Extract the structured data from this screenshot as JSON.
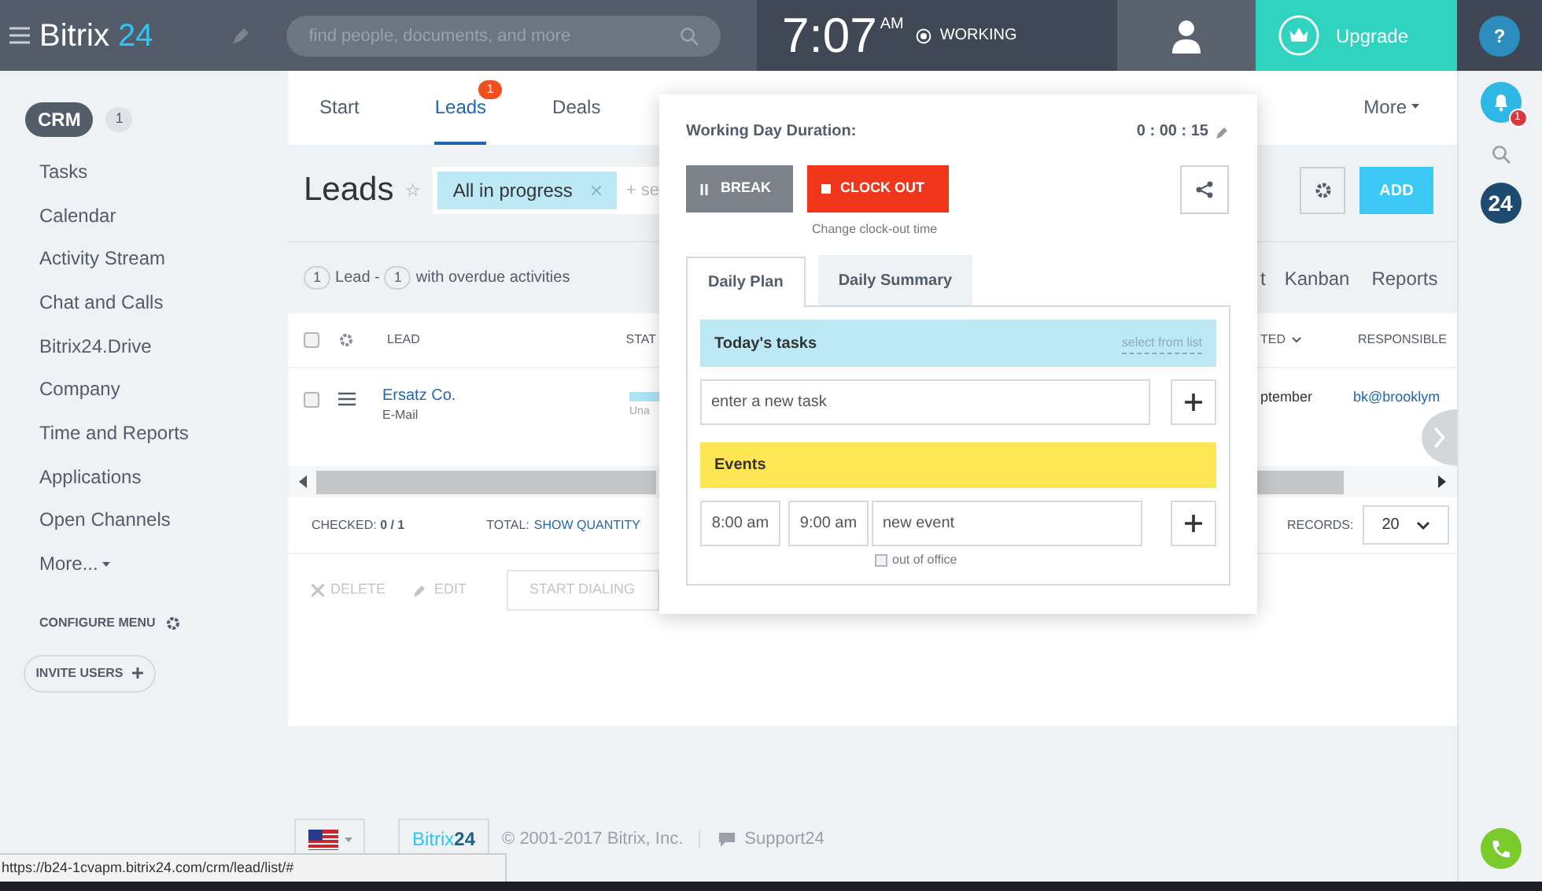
{
  "top_bar": {
    "logo": "Bitrix",
    "logo_accent": "24",
    "search_placeholder": "find people, documents, and more",
    "time": "7:07",
    "time_suffix": "AM",
    "work_status": "WORKING",
    "upgrade": "Upgrade"
  },
  "sidebar": {
    "items": [
      {
        "label": "CRM",
        "counter": "1",
        "selected": true
      },
      {
        "label": "Tasks",
        "selected": false
      },
      {
        "label": "Calendar",
        "selected": false
      },
      {
        "label": "Activity Stream",
        "selected": false
      },
      {
        "label": "Chat and Calls",
        "selected": false
      },
      {
        "label": "Bitrix24.Drive",
        "selected": false
      },
      {
        "label": "Company",
        "selected": false
      },
      {
        "label": "Time and Reports",
        "selected": false
      },
      {
        "label": "Applications",
        "selected": false
      },
      {
        "label": "Open Channels",
        "selected": false
      },
      {
        "label": "More...",
        "selected": false,
        "dropdown": true
      }
    ],
    "configure": "CONFIGURE MENU",
    "invite": "INVITE USERS"
  },
  "tabs": [
    {
      "label": "Start",
      "selected": false
    },
    {
      "label": "Leads",
      "selected": true,
      "badge": "1"
    },
    {
      "label": "Deals",
      "selected": false
    },
    {
      "label": "More",
      "selected": false,
      "dropdown": true
    }
  ],
  "page": {
    "title": "Leads",
    "filter_tag": "All in progress",
    "filter_hint": "+ se",
    "add": "ADD"
  },
  "counters": {
    "lead_count": "1",
    "lead_label": "Lead -",
    "overdue_count": "1",
    "overdue_label": "with overdue activities"
  },
  "views": [
    {
      "label": "t"
    },
    {
      "label": "Kanban"
    },
    {
      "label": "Reports"
    }
  ],
  "table": {
    "header_checked": false,
    "columns": [
      "LEAD",
      "STAT",
      "TED",
      "RESPONSIBLE"
    ],
    "rows": [
      {
        "checked": false,
        "name": "Ersatz Co.",
        "source": "E-Mail",
        "status": "Una",
        "date": "ptember",
        "responsible": "bk@brooklym"
      }
    ]
  },
  "list_footer": {
    "checked_label": "CHECKED:",
    "checked_value": "0 / 1",
    "total_label": "TOTAL:",
    "total_link": "SHOW QUANTITY",
    "records_label": "RECORDS:",
    "records_value": "20"
  },
  "actions": [
    {
      "kind": "delete",
      "label": "DELETE"
    },
    {
      "kind": "edit",
      "label": "EDIT"
    },
    {
      "kind": "button",
      "label": "START DIALING"
    }
  ],
  "page_footer": {
    "brand": "Bitrix",
    "brand_accent": "24",
    "copyright": "© 2001-2017 Bitrix, Inc.",
    "support": "Support24"
  },
  "status_url": "https://b24-1cvapm.bitrix24.com/crm/lead/list/#",
  "right_rail": {
    "help": "?",
    "notifications": "1",
    "b24": "24"
  },
  "popup": {
    "title": "Working Day Duration:",
    "duration": "0 : 00 : 15",
    "break": "BREAK",
    "clock_out": "CLOCK OUT",
    "change_time": "Change clock-out time",
    "tabs": [
      {
        "label": "Daily Plan",
        "selected": true
      },
      {
        "label": "Daily Summary",
        "selected": false
      }
    ],
    "tasks_title": "Today's tasks",
    "select_link": "select from list",
    "task_placeholder": "enter a new task",
    "events_title": "Events",
    "event_from": "8:00 am",
    "event_to": "9:00 am",
    "event_placeholder": "new event",
    "out_of_office": {
      "label": "out of office",
      "checked": false
    }
  }
}
